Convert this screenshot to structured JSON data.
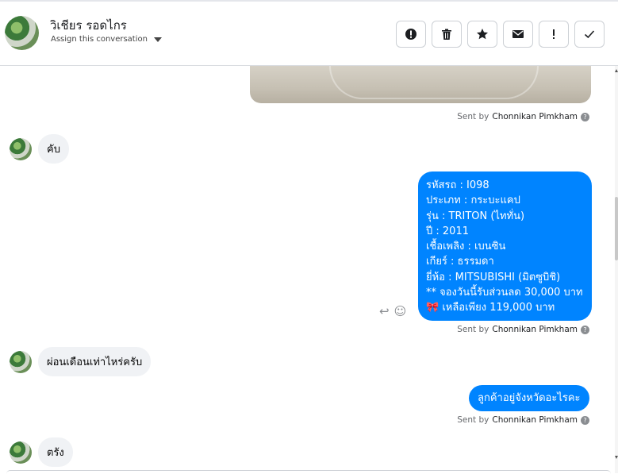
{
  "header": {
    "contact_name": "วิเชียร รอดไกร",
    "assign_label": "Assign this conversation",
    "actions": [
      {
        "name": "spam-button",
        "icon": "alert-circle-icon"
      },
      {
        "name": "delete-button",
        "icon": "trash-icon"
      },
      {
        "name": "star-button",
        "icon": "star-icon"
      },
      {
        "name": "mark-unread-button",
        "icon": "envelope-icon"
      },
      {
        "name": "follow-up-button",
        "icon": "exclamation-icon"
      },
      {
        "name": "done-button",
        "icon": "check-icon"
      }
    ]
  },
  "thread": {
    "sent_by_prefix": "Sent by",
    "agent_name": "Chonnikan Pimkham",
    "messages": [
      {
        "direction": "in",
        "text": "คับ"
      },
      {
        "direction": "out",
        "lines": [
          "รหัสรถ : I098",
          " ประเภท : กระบะแคป",
          " รุ่น : TRITON (ไททั่น)",
          " ปี : 2011",
          " เชื้อเพลิง : เบนซิน",
          " เกียร์ : ธรรมดา",
          " ยี่ห้อ : MITSUBISHI (มิตซูบิชิ)",
          "** จองวันนี้รับส่วนลด 30,000 บาท",
          "🎀 เหลือเพียง 119,000 บาท"
        ]
      },
      {
        "direction": "in",
        "text": "ผ่อนเดือนเท่าไหร่ครับ"
      },
      {
        "direction": "out",
        "text": "ลูกค้าอยู่จังหวัดอะไรคะ"
      },
      {
        "direction": "in",
        "text": "ตรัง"
      }
    ]
  },
  "colors": {
    "accent": "#0084ff",
    "incoming_bubble": "#f0f2f5"
  }
}
